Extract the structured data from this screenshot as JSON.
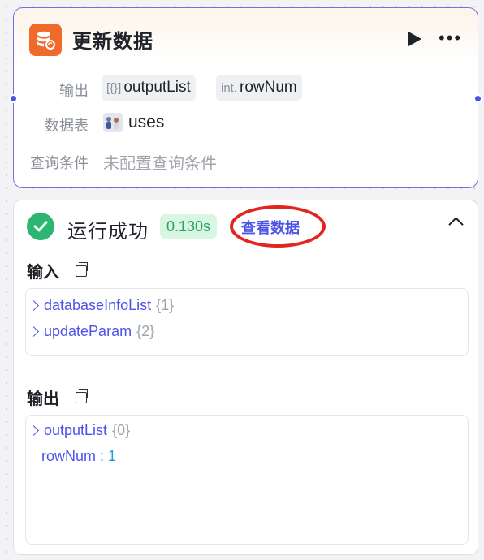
{
  "node": {
    "title": "更新数据",
    "icon": "database-sync-icon",
    "output_label": "输出",
    "outputs": [
      {
        "type": "[{}]",
        "name": "outputList"
      },
      {
        "type": "int.",
        "name": "rowNum"
      }
    ],
    "table_label": "数据表",
    "table_name": "uses",
    "condition_label": "查询条件",
    "condition_value": "未配置查询条件"
  },
  "result": {
    "status": "运行成功",
    "duration": "0.130s",
    "view_data": "查看数据",
    "input_title": "输入",
    "inputs": [
      {
        "key": "databaseInfoList",
        "count": "{1}"
      },
      {
        "key": "updateParam",
        "count": "{2}"
      }
    ],
    "output_title": "输出",
    "output_list": {
      "key": "outputList",
      "count": "{0}"
    },
    "row_num": {
      "key": "rowNum",
      "sep": " : ",
      "value": "1"
    }
  },
  "colors": {
    "accent": "#4d53e8",
    "success": "#2bb673",
    "node_icon": "#f06a2c",
    "annotation": "#e2261f"
  }
}
